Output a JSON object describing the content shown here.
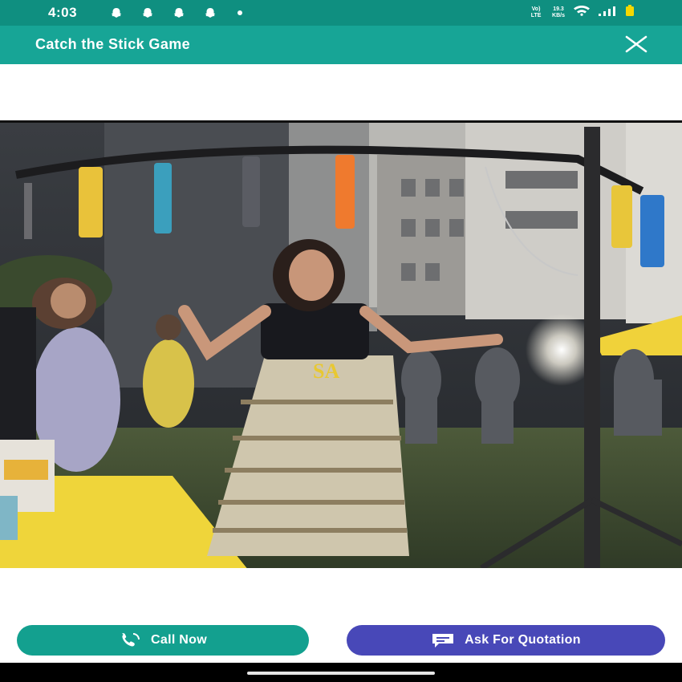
{
  "status_bar": {
    "time": "4:03",
    "network_label": "Vo) LTE",
    "speed_value": "19.3",
    "speed_unit": "KB/s",
    "notification_icons": [
      "snapchat-icon",
      "snapchat-icon",
      "snapchat-icon",
      "snapchat-icon"
    ]
  },
  "app_bar": {
    "title": "Catch the Stick Game",
    "close_icon": "close-icon"
  },
  "media": {
    "video_overlay_text": "SA"
  },
  "actions": {
    "call_label": "Call Now",
    "call_icon": "phone-icon",
    "quote_label": "Ask For Quotation",
    "quote_icon": "chat-icon"
  },
  "colors": {
    "status_bar": "#0f8f80",
    "app_bar": "#17a596",
    "call_button": "#13a08f",
    "quote_button": "#4848b8"
  }
}
